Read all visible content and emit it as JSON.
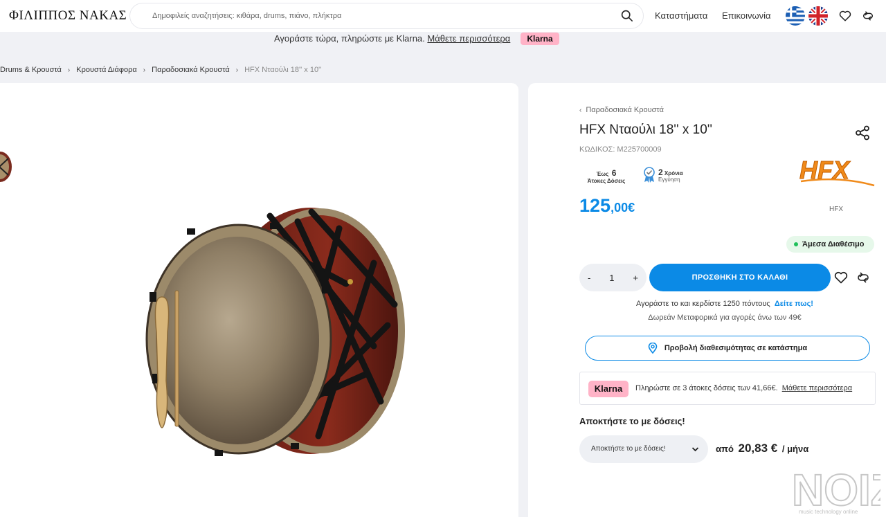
{
  "header": {
    "logo": "ΦΙΛΙΠΠΟΣ ΝΑΚΑΣ",
    "search_placeholder": "Δημοφιλείς αναζητήσεις: κιθάρα, drums, πιάνο, πλήκτρα",
    "nav": [
      "Καταστήματα",
      "Επικοινωνία"
    ]
  },
  "banner": {
    "text": "Αγοράστε τώρα, πληρώστε με Klarna.",
    "link": "Μάθετε περισσότερα",
    "badge": "Klarna"
  },
  "breadcrumb": [
    "Drums & Κρουστά",
    "Κρουστά Διάφορα",
    "Παραδοσιακά Κρουστά",
    "HFX Νταούλι 18'' x 10''"
  ],
  "product": {
    "back_label": "Παραδοσιακά Κρουστά",
    "title": "HFX Νταούλι 18'' x 10''",
    "code": "ΚΩΔΙΚΟΣ: M225700009",
    "installments": {
      "prefix": "Έως",
      "count": "6",
      "label": "Άτοκες Δόσεις"
    },
    "warranty": {
      "years": "2",
      "unit": "Χρόνια",
      "label": "Εγγύηση"
    },
    "price_int": "125",
    "price_dec": ",00€",
    "brand": "HFX",
    "brand_logo_text": "HFX",
    "availability": "Άμεσα Διαθέσιμο",
    "qty_minus": "-",
    "quantity": "1",
    "qty_plus": "+",
    "add_to_cart": "ΠΡΟΣΘΗΚΗ ΣΤΟ ΚΑΛΑΘΙ",
    "points_text": "Αγοράστε το και κερδίστε 1250 πόντους",
    "points_link": "Δείτε πως!",
    "shipping": "Δωρεάν Μεταφορικά για αγορές άνω των 49€",
    "store_button": "Προβολή διαθεσιμότητας σε κατάστημα",
    "klarna_badge": "Klarna",
    "klarna_text": "Πληρώστε σε 3 άτοκες δόσεις των 41,66€.",
    "klarna_link": "Μάθετε περισσότερα",
    "installments_heading": "Αποκτήστε το με δόσεις!",
    "installments_select": "Αποκτήστε το με δόσεις!",
    "from_label": "από",
    "from_amount": "20,83 €",
    "per_month": "/ μήνα"
  },
  "watermark": {
    "brand": "NOIZ",
    "tagline": "music technology online"
  },
  "colors": {
    "accent": "#0b8ae6",
    "klarna": "#ffb3c7",
    "available": "#1fc05a"
  }
}
